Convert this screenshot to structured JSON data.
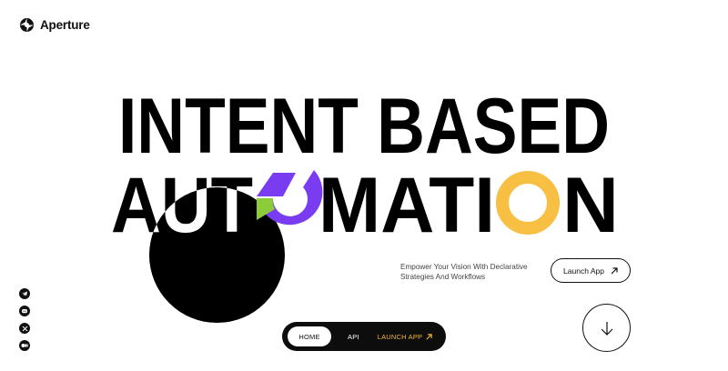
{
  "brand": {
    "name": "Aperture",
    "logo_icon": "aperture-logo-icon"
  },
  "hero": {
    "line1": "INTENT BASED",
    "line2_part1": "AUT",
    "line2_part2": "MATI",
    "line2_part3": "N"
  },
  "tagline": "Empower Your Vision With Declarative Strategies And Workflows",
  "cta": {
    "label": "Launch App",
    "icon": "arrow-up-right-icon"
  },
  "scroll": {
    "icon": "arrow-down-icon"
  },
  "social": [
    "telegram-icon",
    "discord-icon",
    "x-icon",
    "medium-icon"
  ],
  "nav": {
    "home": "HOME",
    "api": "API",
    "launch": "LAUNCH APP"
  },
  "colors": {
    "purple": "#7a3cf0",
    "green": "#8ccc3a",
    "yellow": "#f7c043",
    "black": "#000000"
  }
}
